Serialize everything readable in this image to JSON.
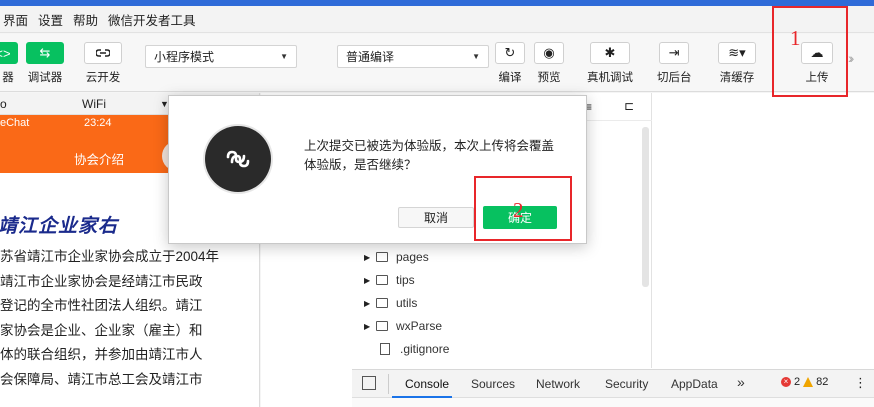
{
  "menubar": {
    "items": [
      "界面",
      "设置",
      "帮助",
      "微信开发者工具"
    ]
  },
  "toolbar": {
    "left_label_frag": "器",
    "debugger_label": "调试器",
    "cloud_label": "云开发",
    "mode_select": "小程序模式",
    "compile_select": "普通编译",
    "compile_label": "编译",
    "preview_label": "预览",
    "device_debug_label": "真机调试",
    "background_label": "切后台",
    "clear_cache_label": "清缓存",
    "upload_label": "上传"
  },
  "simulator": {
    "device_frag": "o",
    "network": "WiFi",
    "status_left": "eChat",
    "status_time": "23:24",
    "nav_title": "协会介绍",
    "heading": "靖江企业家右",
    "body_lines": [
      "苏省靖江市企业家协会成立于2004年",
      "靖江市企业家协会是经靖江市民政",
      "登记的全市性社团法人组织。靖江",
      "家协会是企业、企业家（雇主）和",
      "体的联合组织，并参加由靖江市人",
      "会保障局、靖江市总工会及靖江市"
    ]
  },
  "file_tree": {
    "items": [
      {
        "name": "pages",
        "type": "folder"
      },
      {
        "name": "tips",
        "type": "folder"
      },
      {
        "name": "utils",
        "type": "folder"
      },
      {
        "name": "wxParse",
        "type": "folder"
      },
      {
        "name": ".gitignore",
        "type": "file"
      }
    ]
  },
  "console": {
    "tabs": [
      "Console",
      "Sources",
      "Network",
      "Security",
      "AppData"
    ],
    "more": "»",
    "errors": "2",
    "warnings": "82"
  },
  "dialog": {
    "message": "上次提交已被选为体验版，本次上传将会覆盖体验版，是否继续？",
    "cancel": "取消",
    "confirm": "确定"
  },
  "annotations": {
    "one": "1",
    "two": "2"
  },
  "colors": {
    "accent_green": "#07c160",
    "phone_header": "#fa6917",
    "annotation_red": "#e8262a"
  }
}
